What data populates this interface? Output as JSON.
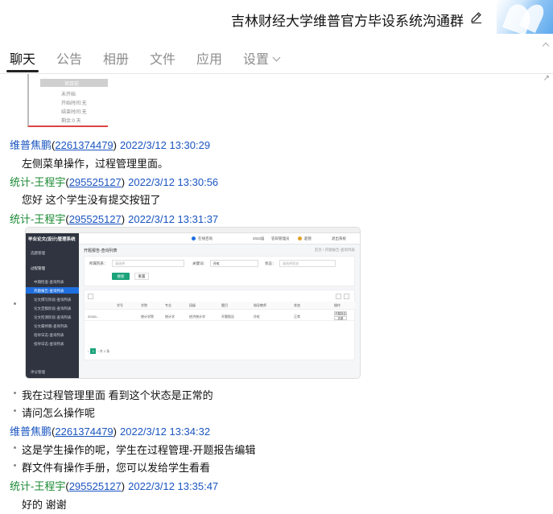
{
  "window": {
    "title": "吉林财经大学维普官方毕设系统沟通群",
    "edit_icon": "pencil-icon"
  },
  "tabs": [
    {
      "label": "聊天",
      "active": true
    },
    {
      "label": "公告"
    },
    {
      "label": "相册"
    },
    {
      "label": "文件"
    },
    {
      "label": "应用"
    },
    {
      "label": "设置"
    }
  ],
  "partial_image": {
    "bar_label": "项目前",
    "lines": [
      "未开始",
      "开始时间:无",
      "结束时间:无",
      "剩余:0 天"
    ]
  },
  "messages": [
    {
      "sender": "维普焦鹏",
      "qq": "2261374479",
      "time": "2022/3/12 13:30:29",
      "lines": [
        "左侧菜单操作，过程管理里面。"
      ]
    },
    {
      "sender": "统计-王程宇",
      "qq": "295525127",
      "time": "2022/3/12 13:30:56",
      "lines": [
        "您好 这个学生没有提交按钮了"
      ]
    },
    {
      "sender": "统计-王程宇",
      "qq": "295525127",
      "time": "2022/3/12 13:31:37",
      "lines": [
        "我在过程管理里面 看到这个状态是正常的",
        "请问怎么操作呢"
      ]
    },
    {
      "sender": "维普焦鹏",
      "qq": "2261374479",
      "time": "2022/3/12 13:34:32",
      "lines": [
        "这是学生操作的呢，学生在过程管理-开题报告编辑",
        "群文件有操作手册，您可以发给学生看看"
      ]
    },
    {
      "sender": "统计-王程宇",
      "qq": "295525127",
      "time": "2022/3/12 13:35:47",
      "lines": [
        "好的 谢谢"
      ]
    }
  ],
  "screenshot": {
    "brand": "毕业论文(设计)管理系统",
    "sidebar": [
      "选题管理",
      "过程管理",
      "中期检查-查询列表",
      "开题报告-查询列表",
      "论文撰写阶段-查询列表",
      "论文定稿阶段-查询列表",
      "论文检测阶段-查询列表",
      "论文最终稿-查询列表",
      "指导日志-查询列表",
      "指导日志-查询列表",
      "评分管理"
    ],
    "topnav": [
      "在线咨询",
      "2022届",
      "答辩管理员",
      "超管",
      "退出系统"
    ],
    "page_title": "开题报告-查询列表",
    "breadcrumb": "首页 / 开题报告-查询列表",
    "filters": {
      "college_label": "所属院系：",
      "college_value": "请选择",
      "keyword_label": "关键词：",
      "keyword_value": "孙虹",
      "status_label": "状态：",
      "status_value": "请选择状态"
    },
    "search_button": "搜索",
    "reset_button": "重置",
    "columns": [
      "学号",
      "学院",
      "专业",
      "班级",
      "题目",
      "指导教师",
      "状态",
      "操作"
    ],
    "row": [
      "20181...",
      "统计学院",
      "统计学",
      "经济统计学",
      "开题报告",
      "孙虹",
      "正常",
      "开题报告"
    ],
    "op_buttons": [
      "开题报告",
      "查看"
    ],
    "pager": "共 1 条"
  }
}
